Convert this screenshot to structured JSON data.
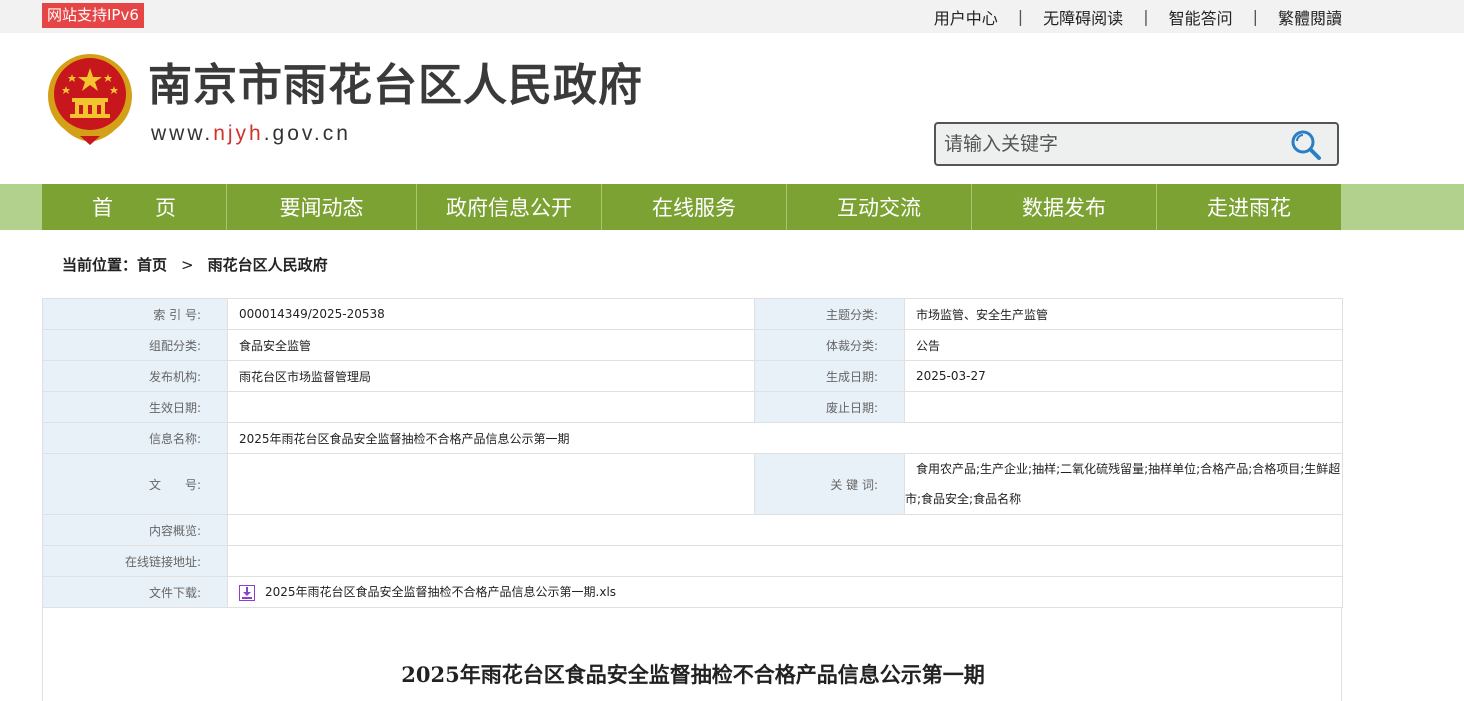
{
  "topbar": {
    "ipv6_badge": "网站支持IPv6",
    "links": [
      "用户中心",
      "无障碍阅读",
      "智能答问",
      "繁體閱讀"
    ],
    "separator": "|"
  },
  "header": {
    "title": "南京市雨花台区人民政府",
    "url_prefix": "www.",
    "url_highlight": "njyh",
    "url_suffix": ".gov.cn",
    "emblem_icon": "national-emblem-icon"
  },
  "search": {
    "placeholder": "请输入关键字",
    "icon": "search-icon"
  },
  "nav": {
    "items": [
      "首　　页",
      "要闻动态",
      "政府信息公开",
      "在线服务",
      "互动交流",
      "数据发布",
      "走进雨花"
    ]
  },
  "breadcrumb": {
    "label": "当前位置：",
    "home": "首页",
    "arrow": ">",
    "current": "雨花台区人民政府"
  },
  "meta": {
    "index_no_label": "索 引 号:",
    "index_no": "000014349/2025-20538",
    "topic_label": "主题分类:",
    "topic": "市场监管、安全生产监管",
    "category_label": "组配分类:",
    "category": "食品安全监管",
    "genre_label": "体裁分类:",
    "genre": "公告",
    "publisher_label": "发布机构:",
    "publisher": "雨花台区市场监督管理局",
    "created_label": "生成日期:",
    "created": "2025-03-27",
    "effective_label": "生效日期:",
    "effective": "",
    "abolished_label": "废止日期:",
    "abolished": "",
    "name_label": "信息名称:",
    "name": "2025年雨花台区食品安全监督抽检不合格产品信息公示第一期",
    "docno_label": "文　　号:",
    "docno": "",
    "keywords_label": "关 键 词:",
    "keywords": "食用农产品;生产企业;抽样;二氧化硫残留量;抽样单位;合格产品;合格项目;生鲜超市;食品安全;食品名称",
    "summary_label": "内容概览:",
    "summary": "",
    "link_label": "在线链接地址:",
    "link": "",
    "download_label": "文件下载:",
    "download": "2025年雨花台区食品安全监督抽检不合格产品信息公示第一期.xls"
  },
  "article": {
    "title": "2025年雨花台区食品安全监督抽检不合格产品信息公示第一期"
  },
  "colors": {
    "nav_bg": "#7ba233",
    "nav_outer": "#b2d18c",
    "ipv6_bg": "#e64545",
    "label_bg": "#e8f0f8",
    "url_highlight": "#d0332b"
  }
}
